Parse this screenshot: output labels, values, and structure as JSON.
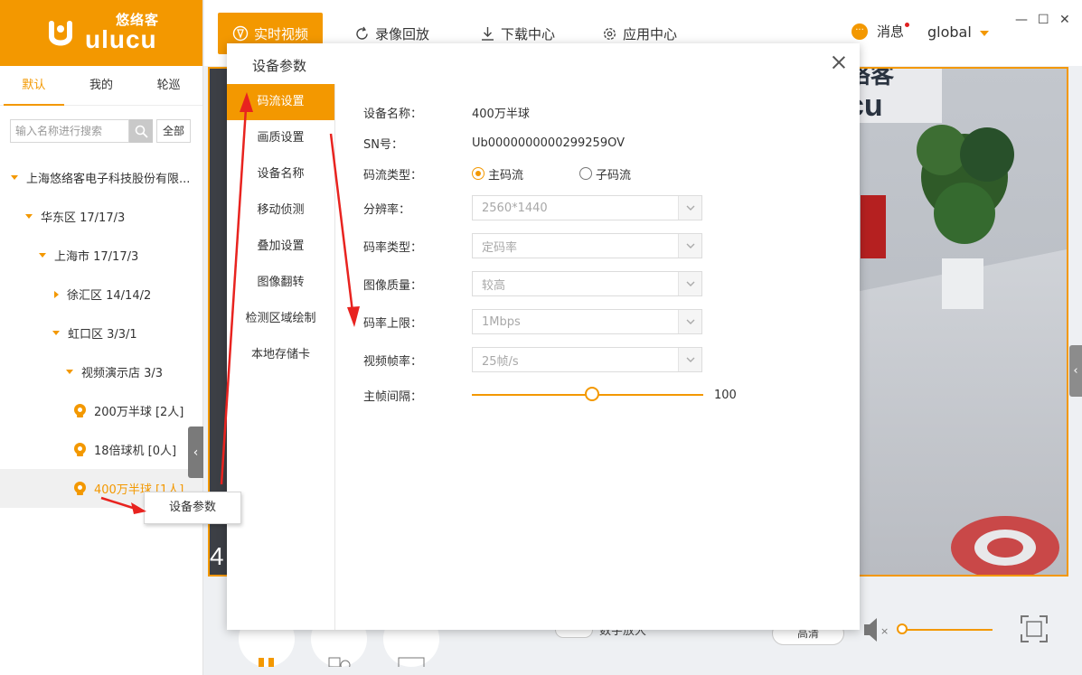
{
  "app": {
    "logo_cn": "悠络客",
    "logo_en": "ulucu"
  },
  "sidebar": {
    "tabs": [
      {
        "label": "默认",
        "active": true
      },
      {
        "label": "我的",
        "active": false
      },
      {
        "label": "轮巡",
        "active": false
      }
    ],
    "search_placeholder": "输入名称进行搜索",
    "all_label": "全部",
    "tree": [
      {
        "label": "上海悠络客电子科技股份有限...",
        "type": "folder",
        "expanded": true
      },
      {
        "label": "华东区   17/17/3",
        "type": "folder",
        "expanded": true
      },
      {
        "label": "上海市   17/17/3",
        "type": "folder",
        "expanded": true
      },
      {
        "label": "徐汇区   14/14/2",
        "type": "folder",
        "expanded": false
      },
      {
        "label": "虹口区   3/3/1",
        "type": "folder",
        "expanded": true
      },
      {
        "label": "视频演示店   3/3",
        "type": "folder",
        "expanded": true
      },
      {
        "label": "200万半球  [2人]",
        "type": "camera"
      },
      {
        "label": "18倍球机  [0人]",
        "type": "camera"
      },
      {
        "label": "400万半球  [1人]",
        "type": "camera",
        "selected": true
      }
    ]
  },
  "topnav": {
    "items": [
      {
        "label": "实时视频",
        "icon": "realtime-video-icon",
        "active": true
      },
      {
        "label": "录像回放",
        "icon": "replay-icon",
        "active": false
      },
      {
        "label": "下载中心",
        "icon": "download-icon",
        "active": false
      },
      {
        "label": "应用中心",
        "icon": "gear-icon",
        "active": false
      }
    ],
    "messages_label": "消息",
    "user_name": "global"
  },
  "window_controls": {
    "minimize": "—",
    "maximize": "☐",
    "close": "✕"
  },
  "video": {
    "overlay_text": "4",
    "sign_text": "络客",
    "sign_text2": "cu"
  },
  "bottom": {
    "digital_zoom_label": "数字放大",
    "quality_label": "高清"
  },
  "context_menu": {
    "item": "设备参数"
  },
  "dialog": {
    "title": "设备参数",
    "menu": [
      {
        "label": "码流设置",
        "active": true
      },
      {
        "label": "画质设置",
        "active": false
      },
      {
        "label": "设备名称",
        "active": false
      },
      {
        "label": "移动侦测",
        "active": false
      },
      {
        "label": "叠加设置",
        "active": false
      },
      {
        "label": "图像翻转",
        "active": false
      },
      {
        "label": "检测区域绘制",
        "active": false
      },
      {
        "label": "本地存储卡",
        "active": false
      }
    ],
    "fields": {
      "device_name_label": "设备名称：",
      "device_name": "400万半球",
      "sn_label": "SN号：",
      "sn": "Ub0000000000299259OV",
      "stream_type_label": "码流类型：",
      "stream_main": "主码流",
      "stream_sub": "子码流",
      "stream_selected": "main",
      "resolution_label": "分辨率：",
      "resolution": "2560*1440",
      "bitrate_type_label": "码率类型：",
      "bitrate_type": "定码率",
      "quality_label": "图像质量：",
      "quality": "较高",
      "bitrate_limit_label": "码率上限：",
      "bitrate_limit": "1Mbps",
      "framerate_label": "视频帧率：",
      "framerate": "25帧/s",
      "iframe_label": "主帧间隔：",
      "iframe_value": "100",
      "iframe_fraction": 0.52
    }
  },
  "colors": {
    "accent": "#f39800",
    "arrow": "#e8231f"
  }
}
